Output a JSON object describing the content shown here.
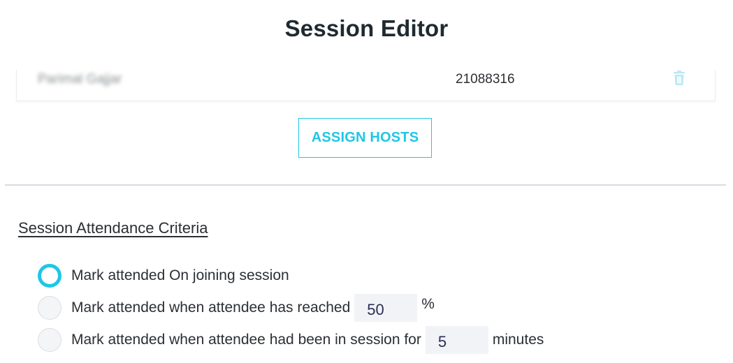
{
  "page": {
    "title": "Session Editor"
  },
  "hosts": {
    "rows": [
      {
        "name": "Parimal Gajjar",
        "id": "21088316"
      }
    ],
    "assign_button_label": "ASSIGN HOSTS"
  },
  "attendance": {
    "heading": "Session Attendance Criteria",
    "options": [
      {
        "label": "Mark attended On joining session",
        "selected": true
      },
      {
        "label": "Mark attended when attendee has reached",
        "value": "50",
        "suffix": "%",
        "selected": false
      },
      {
        "label": "Mark attended when attendee had been in session for",
        "value": "5",
        "suffix": "minutes",
        "selected": false
      }
    ]
  },
  "colors": {
    "accent": "#1ec7e6",
    "divider": "#d7dbe0",
    "input_bg": "#f2f3f6"
  },
  "icons": {
    "delete": "trash-icon"
  }
}
